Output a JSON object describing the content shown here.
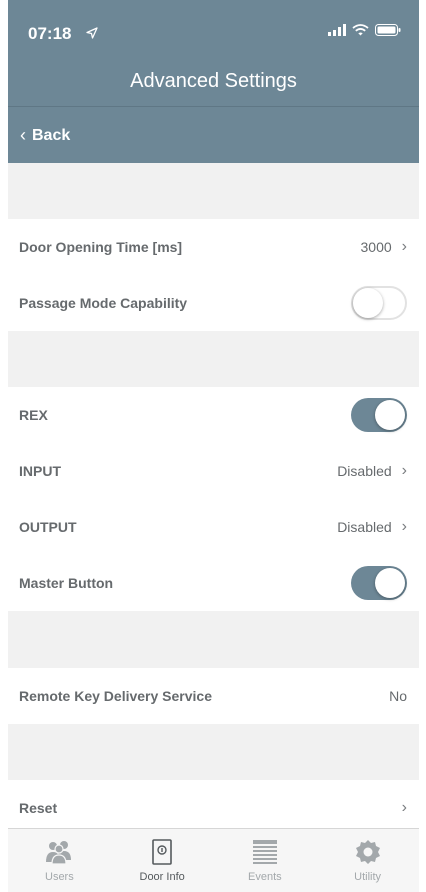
{
  "status_bar": {
    "time": "07:18"
  },
  "header": {
    "title": "Advanced Settings"
  },
  "nav": {
    "back_label": "Back"
  },
  "rows": {
    "door_opening_time": {
      "label": "Door Opening Time [ms]",
      "value": "3000"
    },
    "passage_mode": {
      "label": "Passage Mode Capability",
      "state": "off"
    },
    "rex": {
      "label": "REX",
      "state": "on"
    },
    "input": {
      "label": "INPUT",
      "value": "Disabled"
    },
    "output": {
      "label": "OUTPUT",
      "value": "Disabled"
    },
    "master_button": {
      "label": "Master Button",
      "state": "on"
    },
    "remote_key": {
      "label": "Remote Key Delivery Service",
      "value": "No"
    },
    "reset": {
      "label": "Reset"
    }
  },
  "tabs": [
    {
      "label": "Users",
      "icon": "users-icon",
      "active": false
    },
    {
      "label": "Door Info",
      "icon": "door-icon",
      "active": true
    },
    {
      "label": "Events",
      "icon": "list-icon",
      "active": false
    },
    {
      "label": "Utility",
      "icon": "gear-icon",
      "active": false
    }
  ],
  "colors": {
    "accent": "#6d8796",
    "row_text": "#666a6d",
    "section_gap": "#f1f1f1",
    "tab_inactive": "#a3a8ab"
  }
}
